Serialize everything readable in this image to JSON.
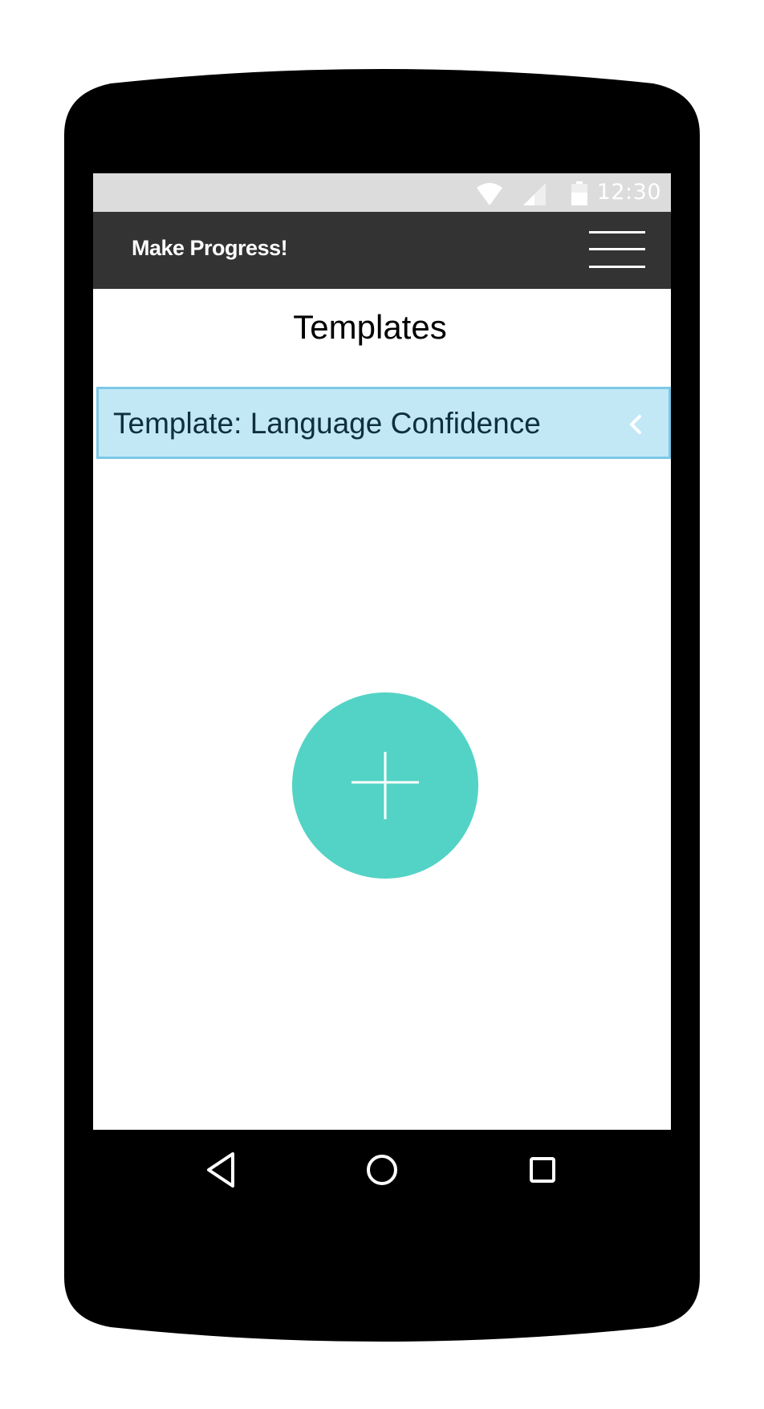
{
  "status_bar": {
    "time": "12:30",
    "icons": [
      "wifi-icon",
      "cellular-signal-icon",
      "battery-icon"
    ]
  },
  "app_bar": {
    "title": "Make Progress!",
    "menu_icon": "hamburger-menu-icon"
  },
  "page": {
    "title": "Templates"
  },
  "templates": [
    {
      "label": "Template: Language Confidence",
      "icon": "chevron-left-icon"
    }
  ],
  "fab": {
    "icon": "plus-icon",
    "color": "#53d3c5"
  },
  "nav": {
    "items": [
      "back-triangle-icon",
      "home-circle-icon",
      "recents-square-icon"
    ]
  },
  "colors": {
    "status_bar": "#dcdcdc",
    "app_bar": "#333333",
    "list_item_bg": "#c2e8f6",
    "list_item_border": "#7cc8e6",
    "phone_body": "#000000"
  }
}
